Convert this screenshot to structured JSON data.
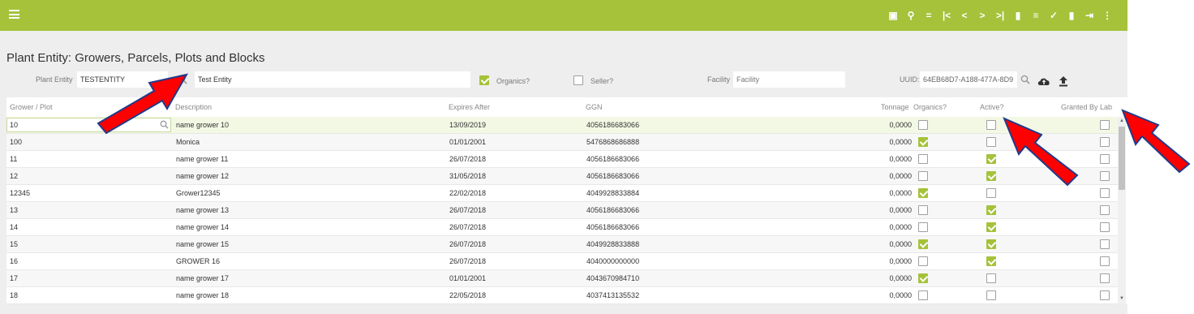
{
  "colors": {
    "accent": "#a5c23a",
    "arrow_fill": "#ff0000",
    "arrow_stroke": "#1f3b8a"
  },
  "topbar": {
    "menu_icon": "hamburger-icon",
    "tools": [
      {
        "name": "calendar-icon",
        "glyph": "▣"
      },
      {
        "name": "search-icon",
        "glyph": "⚲"
      },
      {
        "name": "equals-icon",
        "glyph": "="
      },
      {
        "name": "first-record-icon",
        "glyph": "|<"
      },
      {
        "name": "previous-record-icon",
        "glyph": "<"
      },
      {
        "name": "next-record-icon",
        "glyph": ">"
      },
      {
        "name": "last-record-icon",
        "glyph": ">|"
      },
      {
        "name": "new-document-icon",
        "glyph": "▮"
      },
      {
        "name": "list-icon",
        "glyph": "≡"
      },
      {
        "name": "check-icon",
        "glyph": "✓"
      },
      {
        "name": "delete-icon",
        "glyph": "▮"
      },
      {
        "name": "exit-icon",
        "glyph": "⇥"
      },
      {
        "name": "more-icon",
        "glyph": "⋮"
      }
    ]
  },
  "page": {
    "title": "Plant Entity: Growers, Parcels, Plots and Blocks"
  },
  "filters": {
    "plant_entity_label": "Plant Entity",
    "plant_entity_value": "TESTENTITY",
    "description_value": "Test Entity",
    "organics_label": "Organics?",
    "organics_checked": true,
    "seller_label": "Seller?",
    "seller_checked": false,
    "facility_label": "Facility",
    "facility_placeholder": "Facility",
    "uuid_label": "UUID:",
    "uuid_value": "64EB68D7-A188-477A-8D9"
  },
  "grid": {
    "columns": {
      "grower": "Grower / Plot",
      "description": "Description",
      "expires": "Expires After",
      "ggn": "GGN",
      "tonnage": "Tonnage",
      "organics": "Organics?",
      "active": "Active?",
      "granted": "Granted By Lab"
    },
    "rows": [
      {
        "grower": "10",
        "description": "name grower 10",
        "expires": "13/09/2019",
        "ggn": "4056186683066",
        "tonnage": "0,0000",
        "organics": false,
        "active": false,
        "granted": false
      },
      {
        "grower": "100",
        "description": "Monica",
        "expires": "01/01/2001",
        "ggn": "5476868686888",
        "tonnage": "0,0000",
        "organics": true,
        "active": false,
        "granted": false
      },
      {
        "grower": "11",
        "description": "name grower 11",
        "expires": "26/07/2018",
        "ggn": "4056186683066",
        "tonnage": "0,0000",
        "organics": false,
        "active": true,
        "granted": false
      },
      {
        "grower": "12",
        "description": "name grower 12",
        "expires": "31/05/2018",
        "ggn": "4056186683066",
        "tonnage": "0,0000",
        "organics": false,
        "active": true,
        "granted": false
      },
      {
        "grower": "12345",
        "description": "Grower12345",
        "expires": "22/02/2018",
        "ggn": "4049928833884",
        "tonnage": "0,0000",
        "organics": true,
        "active": false,
        "granted": false
      },
      {
        "grower": "13",
        "description": "name grower 13",
        "expires": "26/07/2018",
        "ggn": "4056186683066",
        "tonnage": "0,0000",
        "organics": false,
        "active": true,
        "granted": false
      },
      {
        "grower": "14",
        "description": "name grower 14",
        "expires": "26/07/2018",
        "ggn": "4056186683066",
        "tonnage": "0,0000",
        "organics": false,
        "active": true,
        "granted": false
      },
      {
        "grower": "15",
        "description": "name grower 15",
        "expires": "26/07/2018",
        "ggn": "4049928833888",
        "tonnage": "0,0000",
        "organics": true,
        "active": true,
        "granted": false
      },
      {
        "grower": "16",
        "description": "GROWER 16",
        "expires": "26/07/2018",
        "ggn": "4040000000000",
        "tonnage": "0,0000",
        "organics": false,
        "active": true,
        "granted": false
      },
      {
        "grower": "17",
        "description": "name grower 17",
        "expires": "01/01/2001",
        "ggn": "4043670984710",
        "tonnage": "0,0000",
        "organics": true,
        "active": false,
        "granted": false
      },
      {
        "grower": "18",
        "description": "name grower 18",
        "expires": "22/05/2018",
        "ggn": "4037413135532",
        "tonnage": "0,0000",
        "organics": false,
        "active": false,
        "granted": false
      }
    ]
  }
}
